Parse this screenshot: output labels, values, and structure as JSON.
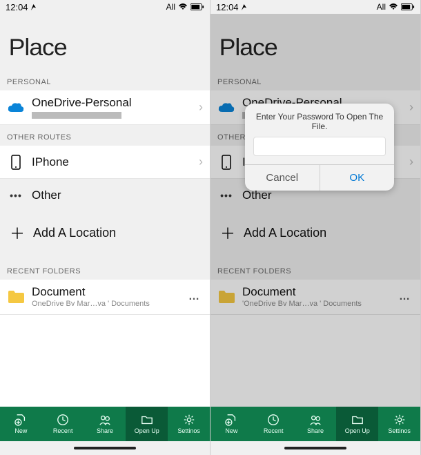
{
  "status": {
    "time": "12:04",
    "right_label": "All"
  },
  "page_title": "Place",
  "sections": {
    "personal_header": "PERSONAL",
    "other_routes_header": "OTHER ROUTES",
    "other_routes_header_short": "OTHER",
    "recent_header": "RECENT FOLDERS"
  },
  "onedrive": {
    "label": "OneDrive-Personal"
  },
  "iphone": {
    "label": "IPhone"
  },
  "other": {
    "label": "Other"
  },
  "add_location": {
    "label": "Add A Location"
  },
  "recent_doc": {
    "primary": "Document",
    "secondary_left": "OneDrive Bv Mar…va ' Documents",
    "secondary_right": "'OneDrive Bv Mar…va ' Documents"
  },
  "tabs": {
    "new": "New",
    "recent": "Recent",
    "share": "Share",
    "open": "Open Up",
    "settings": "Settinos"
  },
  "dialog": {
    "title": "Enter Your Password To Open The File.",
    "cancel": "Cancel",
    "ok": "OK"
  }
}
